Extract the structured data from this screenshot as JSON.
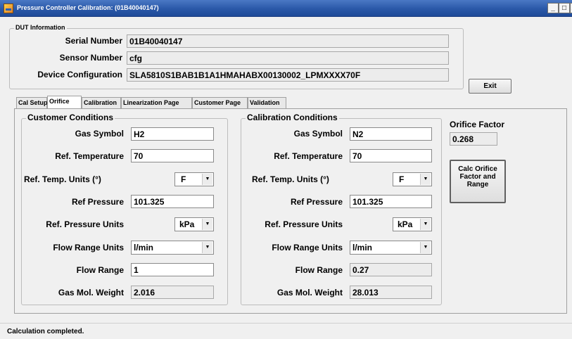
{
  "window": {
    "title": "Pressure Controller Calibration: (01B40040147)",
    "minimize": "_",
    "maximize": "□",
    "close": "X"
  },
  "dut": {
    "group_title": "DUT Information",
    "serial_label": "Serial Number",
    "serial_value": "01B40040147",
    "sensor_label": "Sensor Number",
    "sensor_value": "cfg",
    "config_label": "Device Configuration",
    "config_value": "SLA5810S1BAB1B1A1HMAHABX00130002_LPMXXXX70F"
  },
  "exit_button": "Exit",
  "tabs": [
    {
      "label": "Cal Setup"
    },
    {
      "label": "Orifice",
      "active": true
    },
    {
      "label": "Calibration"
    },
    {
      "label": "Linearization Page"
    },
    {
      "label": "Customer Page"
    },
    {
      "label": "Validation"
    }
  ],
  "customer": {
    "group_title": "Customer Conditions",
    "gas_symbol_label": "Gas Symbol",
    "gas_symbol": "H2",
    "ref_temp_label": "Ref. Temperature",
    "ref_temp": "70",
    "ref_temp_units_label": "Ref. Temp. Units (°)",
    "ref_temp_units": "F",
    "ref_pressure_label": "Ref Pressure",
    "ref_pressure": "101.325",
    "ref_pressure_units_label": "Ref. Pressure Units",
    "ref_pressure_units": "kPa",
    "flow_range_units_label": "Flow Range Units",
    "flow_range_units": "l/min",
    "flow_range_label": "Flow Range",
    "flow_range": "1",
    "mol_weight_label": "Gas Mol. Weight",
    "mol_weight": "2.016"
  },
  "calibration": {
    "group_title": "Calibration Conditions",
    "gas_symbol_label": "Gas Symbol",
    "gas_symbol": "N2",
    "ref_temp_label": "Ref. Temperature",
    "ref_temp": "70",
    "ref_temp_units_label": "Ref. Temp. Units (°)",
    "ref_temp_units": "F",
    "ref_pressure_label": "Ref Pressure",
    "ref_pressure": "101.325",
    "ref_pressure_units_label": "Ref. Pressure Units",
    "ref_pressure_units": "kPa",
    "flow_range_units_label": "Flow Range Units",
    "flow_range_units": "l/min",
    "flow_range_label": "Flow Range",
    "flow_range": "0.27",
    "mol_weight_label": "Gas Mol. Weight",
    "mol_weight": "28.013"
  },
  "orifice": {
    "factor_label": "Orifice Factor",
    "factor_value": "0.268",
    "calc_button": "Calc Orifice Factor and Range"
  },
  "status": {
    "text": "Calculation completed."
  },
  "icons": {
    "app": "app-icon",
    "combo_arrow": "chevron-down-icon"
  }
}
